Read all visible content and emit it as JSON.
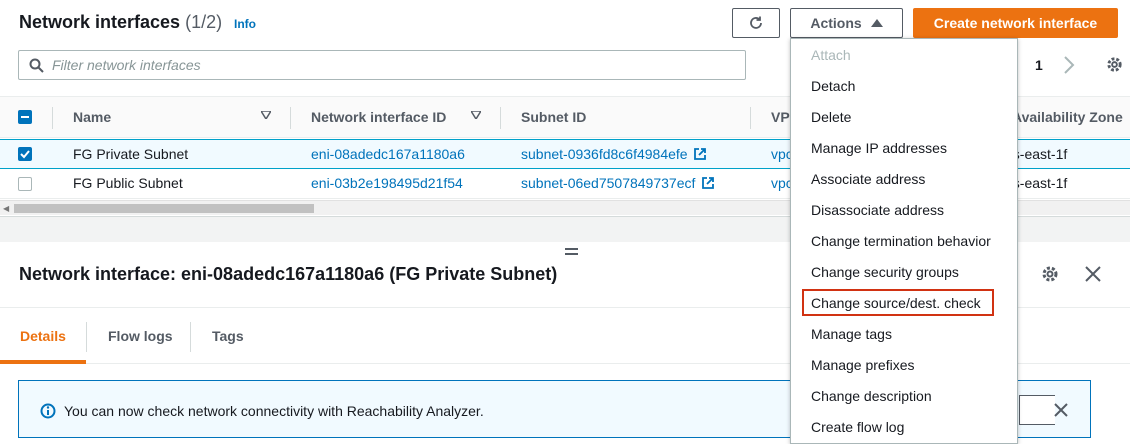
{
  "header": {
    "title": "Network interfaces",
    "count": "(1/2)",
    "info_label": "Info",
    "actions_label": "Actions",
    "create_label": "Create network interface"
  },
  "search": {
    "placeholder": "Filter network interfaces"
  },
  "pagination": {
    "page": "1"
  },
  "table": {
    "columns": [
      "Name",
      "Network interface ID",
      "Subnet ID",
      "VPC",
      "Availability Zone"
    ],
    "rows": [
      {
        "name": "FG Private Subnet",
        "eni": "eni-08adedc167a1180a6",
        "subnet": "subnet-0936fd8c6f4984efe",
        "vpc": "vpc",
        "az": "us-east-1f",
        "selected": true
      },
      {
        "name": "FG Public Subnet",
        "eni": "eni-03b2e198495d21f54",
        "subnet": "subnet-06ed7507849737ecf",
        "vpc": "vpc",
        "az": "us-east-1f",
        "selected": false
      }
    ]
  },
  "details": {
    "title": "Network interface: eni-08adedc167a1180a6 (FG Private Subnet)",
    "tabs": [
      "Details",
      "Flow logs",
      "Tags"
    ],
    "active_tab": "Details",
    "banner_text": "You can now check network connectivity with Reachability Analyzer."
  },
  "actions_menu": {
    "items": [
      {
        "label": "Attach",
        "disabled": true
      },
      {
        "label": "Detach",
        "disabled": false
      },
      {
        "label": "Delete",
        "disabled": false
      },
      {
        "label": "Manage IP addresses",
        "disabled": false
      },
      {
        "label": "Associate address",
        "disabled": false
      },
      {
        "label": "Disassociate address",
        "disabled": false
      },
      {
        "label": "Change termination behavior",
        "disabled": false
      },
      {
        "label": "Change security groups",
        "disabled": false
      },
      {
        "label": "Change source/dest. check",
        "disabled": false,
        "highlighted": true
      },
      {
        "label": "Manage tags",
        "disabled": false
      },
      {
        "label": "Manage prefixes",
        "disabled": false
      },
      {
        "label": "Change description",
        "disabled": false
      },
      {
        "label": "Create flow log",
        "disabled": false
      }
    ]
  },
  "colors": {
    "accent": "#ec7211",
    "link": "#0073bb",
    "highlight": "#d13212"
  },
  "icons": [
    "refresh-icon",
    "caret-up-icon",
    "search-icon",
    "chevron-right-icon",
    "gear-icon",
    "sort-icon",
    "external-link-icon",
    "info-icon",
    "close-icon"
  ]
}
